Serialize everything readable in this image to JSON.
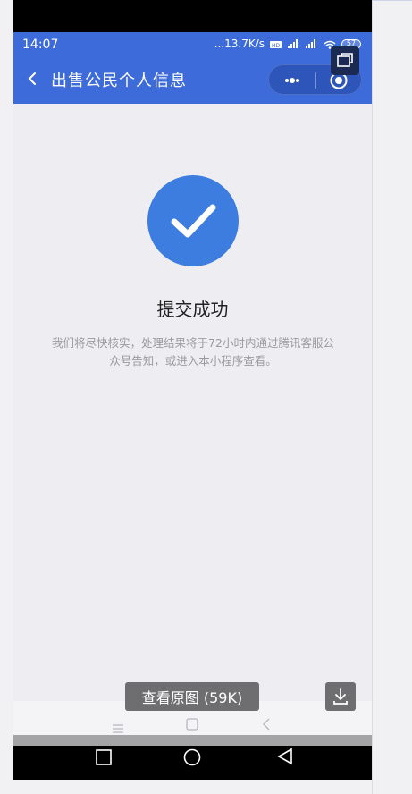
{
  "status_bar": {
    "time": "14:07",
    "speed": "...13.7K/s",
    "battery": "57"
  },
  "header": {
    "title": "出售公民个人信息"
  },
  "result": {
    "title": "提交成功",
    "description": "我们将尽快核实，处理结果将于72小时内通过腾讯客服公众号告知，或进入本小程序查看。"
  },
  "viewer": {
    "view_original_label": "查看原图 (59K)"
  },
  "colors": {
    "appbar": "#3d6bd9",
    "success": "#3d7de0",
    "content_bg": "#eeeef2"
  },
  "icons": [
    "back-icon",
    "more-icon",
    "record-icon",
    "window-icon",
    "check-icon",
    "download-icon",
    "menu-icon",
    "square-icon",
    "circle-icon",
    "triangle-back-icon"
  ]
}
